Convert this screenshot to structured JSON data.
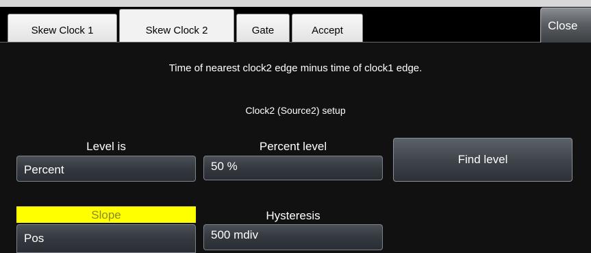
{
  "tabs": [
    {
      "label": "Skew Clock 1",
      "active": false
    },
    {
      "label": "Skew Clock 2",
      "active": true
    },
    {
      "label": "Gate",
      "active": false
    },
    {
      "label": "Accept",
      "active": false
    }
  ],
  "close_label": "Close",
  "description": "Time of nearest clock2 edge minus time of clock1 edge.",
  "setup_heading": "Clock2 (Source2) setup",
  "level_is": {
    "label": "Level is",
    "value": "Percent"
  },
  "percent_level": {
    "label": "Percent level",
    "value": "50 %"
  },
  "find_level_label": "Find level",
  "slope": {
    "label": "Slope",
    "value": "Pos"
  },
  "hysteresis": {
    "label": "Hysteresis",
    "value": "500 mdiv"
  },
  "colors": {
    "background": "#111111",
    "slope_highlight": "#ffff00"
  }
}
